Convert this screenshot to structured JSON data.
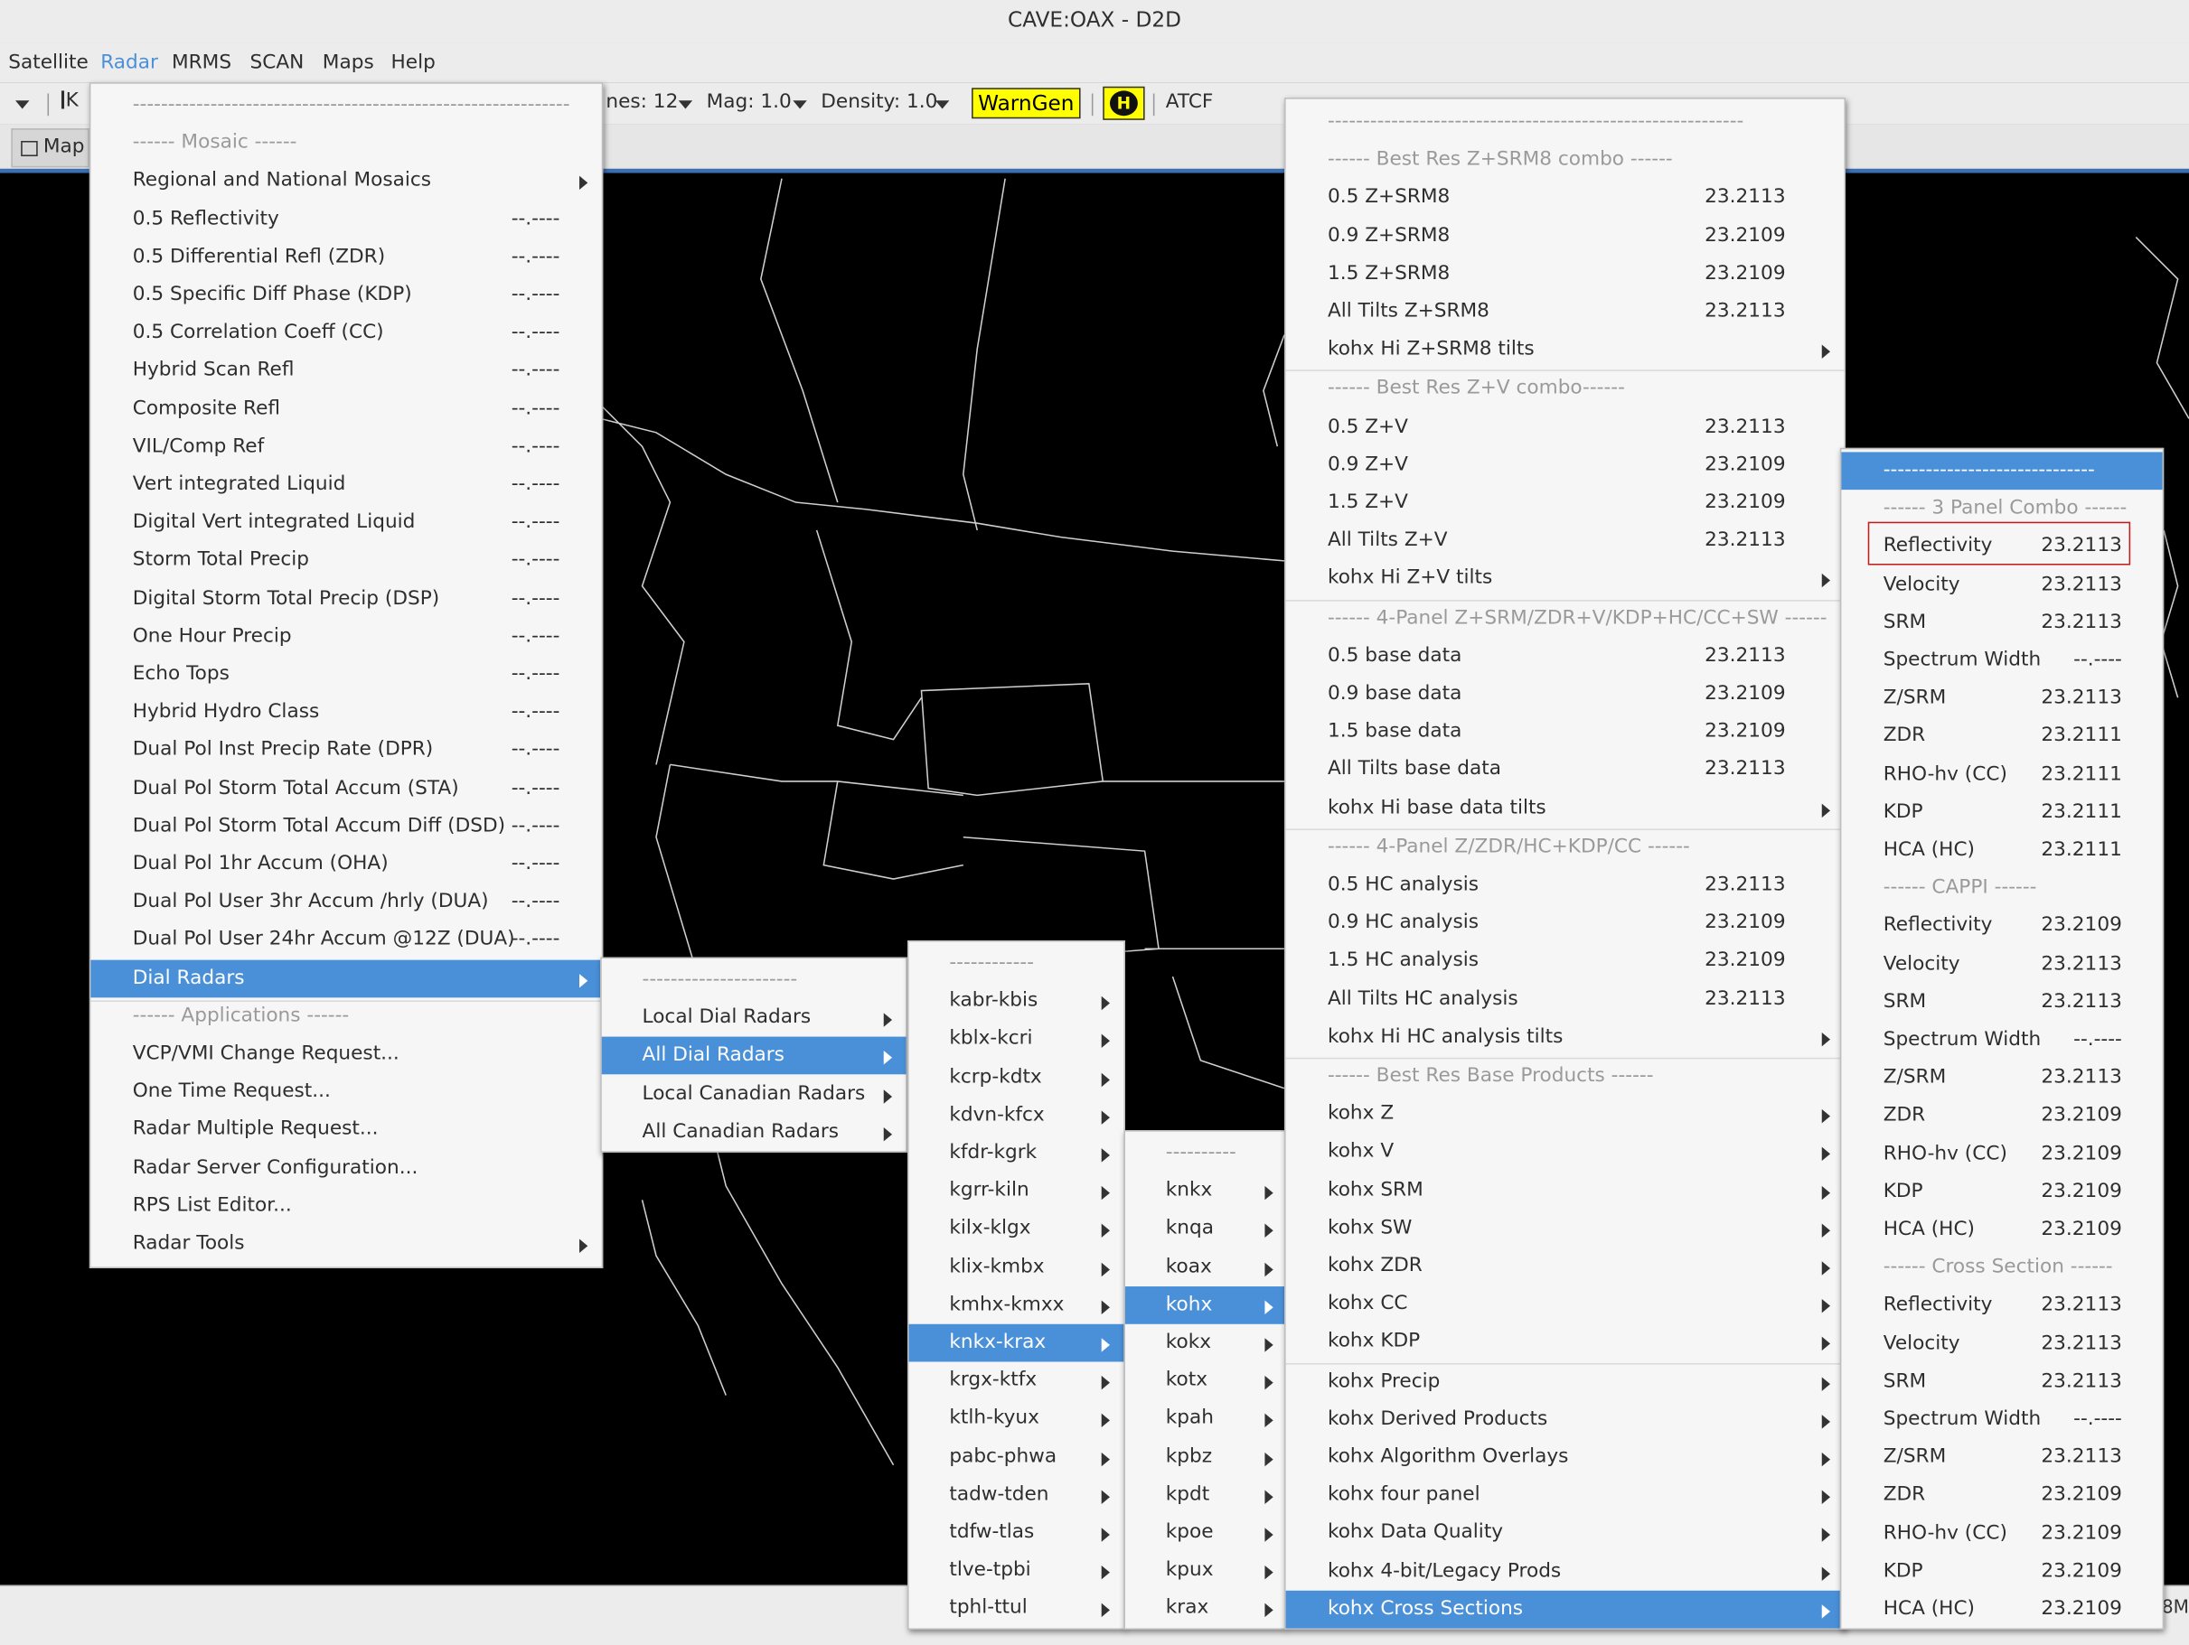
{
  "window": {
    "title": "CAVE:OAX - D2D"
  },
  "menubar": [
    "Satellite",
    "Radar",
    "MRMS",
    "SCAN",
    "Maps",
    "Help"
  ],
  "toolbar": {
    "frames_partial": "nes: 12",
    "mag": "Mag: 1.0",
    "density": "Density: 1.0",
    "warngen": "WarnGen",
    "h_button": "H",
    "atcf": "ATCF",
    "first_frame_glyph": "K"
  },
  "tabs": {
    "map": "Map"
  },
  "status": {
    "right_partial": "8M"
  },
  "menus": {
    "radar": [
      {
        "label": "--------------------------------------------------------------",
        "hdr": true
      },
      {
        "label": "------ Mosaic ------",
        "hdr": true
      },
      {
        "label": "Regional and National Mosaics",
        "sub": true
      },
      {
        "label": "0.5 Reflectivity",
        "val": "--.----"
      },
      {
        "label": "0.5 Differential Refl (ZDR)",
        "val": "--.----"
      },
      {
        "label": "0.5 Specific Diff Phase (KDP)",
        "val": "--.----"
      },
      {
        "label": "0.5 Correlation Coeff (CC)",
        "val": "--.----"
      },
      {
        "label": "Hybrid Scan Refl",
        "val": "--.----"
      },
      {
        "label": "Composite Refl",
        "val": "--.----"
      },
      {
        "label": "VIL/Comp Ref",
        "val": "--.----"
      },
      {
        "label": "Vert integrated Liquid",
        "val": "--.----"
      },
      {
        "label": "Digital Vert integrated Liquid",
        "val": "--.----"
      },
      {
        "label": "Storm Total Precip",
        "val": "--.----"
      },
      {
        "label": "Digital Storm Total Precip (DSP)",
        "val": "--.----"
      },
      {
        "label": "One Hour Precip",
        "val": "--.----"
      },
      {
        "label": "Echo Tops",
        "val": "--.----"
      },
      {
        "label": "Hybrid Hydro Class",
        "val": "--.----"
      },
      {
        "label": "Dual Pol Inst Precip Rate (DPR)",
        "val": "--.----"
      },
      {
        "label": "Dual Pol Storm Total Accum (STA)",
        "val": "--.----"
      },
      {
        "label": "Dual Pol Storm Total Accum Diff (DSD)",
        "val": "--.----"
      },
      {
        "label": "Dual Pol 1hr Accum (OHA)",
        "val": "--.----"
      },
      {
        "label": "Dual Pol User 3hr Accum /hrly (DUA)",
        "val": "--.----"
      },
      {
        "label": "Dual Pol User 24hr Accum @12Z (DUA)",
        "val": "--.----"
      },
      {
        "label": "Dial Radars",
        "sub": true,
        "sel": true
      },
      {
        "label": "------ Applications ------",
        "hdr": true
      },
      {
        "label": "VCP/VMI Change Request..."
      },
      {
        "label": "One Time Request..."
      },
      {
        "label": "Radar Multiple Request..."
      },
      {
        "label": "Radar Server Configuration..."
      },
      {
        "label": "RPS List Editor..."
      },
      {
        "label": "Radar Tools",
        "sub": true
      }
    ],
    "dial": [
      {
        "label": "----------------------",
        "hdr": true
      },
      {
        "label": "Local Dial Radars",
        "sub": true
      },
      {
        "label": "All Dial Radars",
        "sub": true,
        "sel": true
      },
      {
        "label": "Local Canadian Radars",
        "sub": true
      },
      {
        "label": "All Canadian Radars",
        "sub": true
      }
    ],
    "ranges": [
      {
        "label": "------------",
        "hdr": true
      },
      {
        "label": "kabr-kbis",
        "sub": true
      },
      {
        "label": "kblx-kcri",
        "sub": true
      },
      {
        "label": "kcrp-kdtx",
        "sub": true
      },
      {
        "label": "kdvn-kfcx",
        "sub": true
      },
      {
        "label": "kfdr-kgrk",
        "sub": true
      },
      {
        "label": "kgrr-kiln",
        "sub": true
      },
      {
        "label": "kilx-klgx",
        "sub": true
      },
      {
        "label": "klix-kmbx",
        "sub": true
      },
      {
        "label": "kmhx-kmxx",
        "sub": true
      },
      {
        "label": "knkx-krax",
        "sub": true,
        "sel": true
      },
      {
        "label": "krgx-ktfx",
        "sub": true
      },
      {
        "label": "ktlh-kyux",
        "sub": true
      },
      {
        "label": "pabc-phwa",
        "sub": true
      },
      {
        "label": "tadw-tden",
        "sub": true
      },
      {
        "label": "tdfw-tlas",
        "sub": true
      },
      {
        "label": "tlve-tpbi",
        "sub": true
      },
      {
        "label": "tphl-ttul",
        "sub": true
      }
    ],
    "sites": [
      {
        "label": "----------",
        "hdr": true
      },
      {
        "label": "knkx",
        "sub": true
      },
      {
        "label": "knqa",
        "sub": true
      },
      {
        "label": "koax",
        "sub": true
      },
      {
        "label": "kohx",
        "sub": true,
        "sel": true
      },
      {
        "label": "kokx",
        "sub": true
      },
      {
        "label": "kotx",
        "sub": true
      },
      {
        "label": "kpah",
        "sub": true
      },
      {
        "label": "kpbz",
        "sub": true
      },
      {
        "label": "kpdt",
        "sub": true
      },
      {
        "label": "kpoe",
        "sub": true
      },
      {
        "label": "kpux",
        "sub": true
      },
      {
        "label": "krax",
        "sub": true
      }
    ],
    "kohx": [
      {
        "label": "-----------------------------------------------------------",
        "hdr": true
      },
      {
        "label": "------ Best Res Z+SRM8 combo ------",
        "hdr": true
      },
      {
        "label": "0.5 Z+SRM8",
        "val": "23.2113"
      },
      {
        "label": "0.9 Z+SRM8",
        "val": "23.2109"
      },
      {
        "label": "1.5 Z+SRM8",
        "val": "23.2109"
      },
      {
        "label": "All Tilts Z+SRM8",
        "val": "23.2113"
      },
      {
        "label": "kohx Hi Z+SRM8 tilts",
        "sub": true,
        "sepAfter": true
      },
      {
        "label": "------ Best Res Z+V combo------",
        "hdr": true
      },
      {
        "label": "0.5 Z+V",
        "val": "23.2113"
      },
      {
        "label": "0.9 Z+V",
        "val": "23.2109"
      },
      {
        "label": "1.5 Z+V",
        "val": "23.2109"
      },
      {
        "label": "All Tilts Z+V",
        "val": "23.2113"
      },
      {
        "label": "kohx Hi Z+V tilts",
        "sub": true,
        "sepAfter": true
      },
      {
        "label": "------ 4-Panel Z+SRM/ZDR+V/KDP+HC/CC+SW ------",
        "hdr": true
      },
      {
        "label": "0.5 base data",
        "val": "23.2113"
      },
      {
        "label": "0.9 base data",
        "val": "23.2109"
      },
      {
        "label": "1.5 base data",
        "val": "23.2109"
      },
      {
        "label": "All Tilts base data",
        "val": "23.2113"
      },
      {
        "label": "kohx Hi base data tilts",
        "sub": true,
        "sepAfter": true
      },
      {
        "label": "------ 4-Panel Z/ZDR/HC+KDP/CC ------",
        "hdr": true
      },
      {
        "label": "0.5 HC analysis",
        "val": "23.2113"
      },
      {
        "label": "0.9 HC analysis",
        "val": "23.2109"
      },
      {
        "label": "1.5 HC analysis",
        "val": "23.2109"
      },
      {
        "label": "All Tilts HC analysis",
        "val": "23.2113"
      },
      {
        "label": "kohx Hi HC analysis tilts",
        "sub": true,
        "sepAfter": true
      },
      {
        "label": "------ Best Res Base Products ------",
        "hdr": true
      },
      {
        "label": "kohx Z",
        "sub": true
      },
      {
        "label": "kohx V",
        "sub": true
      },
      {
        "label": "kohx SRM",
        "sub": true
      },
      {
        "label": "kohx SW",
        "sub": true
      },
      {
        "label": "kohx ZDR",
        "sub": true
      },
      {
        "label": "kohx CC",
        "sub": true
      },
      {
        "label": "kohx KDP",
        "sub": true,
        "sepAfter": true
      },
      {
        "label": "kohx Precip",
        "sub": true
      },
      {
        "label": "kohx Derived Products",
        "sub": true
      },
      {
        "label": "kohx Algorithm Overlays",
        "sub": true
      },
      {
        "label": "kohx four panel",
        "sub": true
      },
      {
        "label": "kohx Data Quality",
        "sub": true
      },
      {
        "label": "kohx 4-bit/Legacy Prods",
        "sub": true
      },
      {
        "label": "kohx Cross Sections",
        "sub": true,
        "sel": true
      }
    ],
    "cross": [
      {
        "label": "------------------------------",
        "sel": true
      },
      {
        "label": "------ 3 Panel Combo ------",
        "hdr": true
      },
      {
        "label": "Reflectivity",
        "val": "23.2113"
      },
      {
        "label": "Velocity",
        "val": "23.2113"
      },
      {
        "label": "SRM",
        "val": "23.2113"
      },
      {
        "label": "Spectrum Width",
        "val": "--.----"
      },
      {
        "label": "Z/SRM",
        "val": "23.2113"
      },
      {
        "label": "ZDR",
        "val": "23.2111"
      },
      {
        "label": "RHO-hv (CC)",
        "val": "23.2111"
      },
      {
        "label": "KDP",
        "val": "23.2111"
      },
      {
        "label": "HCA (HC)",
        "val": "23.2111"
      },
      {
        "label": "------ CAPPI ------",
        "hdr": true
      },
      {
        "label": "Reflectivity",
        "val": "23.2109"
      },
      {
        "label": "Velocity",
        "val": "23.2113"
      },
      {
        "label": "SRM",
        "val": "23.2113"
      },
      {
        "label": "Spectrum Width",
        "val": "--.----"
      },
      {
        "label": "Z/SRM",
        "val": "23.2113"
      },
      {
        "label": "ZDR",
        "val": "23.2109"
      },
      {
        "label": "RHO-hv (CC)",
        "val": "23.2109"
      },
      {
        "label": "KDP",
        "val": "23.2109"
      },
      {
        "label": "HCA (HC)",
        "val": "23.2109"
      },
      {
        "label": "------ Cross Section ------",
        "hdr": true
      },
      {
        "label": "Reflectivity",
        "val": "23.2113"
      },
      {
        "label": "Velocity",
        "val": "23.2113"
      },
      {
        "label": "SRM",
        "val": "23.2113"
      },
      {
        "label": "Spectrum Width",
        "val": "--.----"
      },
      {
        "label": "Z/SRM",
        "val": "23.2113"
      },
      {
        "label": "ZDR",
        "val": "23.2109"
      },
      {
        "label": "RHO-hv (CC)",
        "val": "23.2109"
      },
      {
        "label": "KDP",
        "val": "23.2109"
      },
      {
        "label": "HCA (HC)",
        "val": "23.2109"
      }
    ]
  }
}
